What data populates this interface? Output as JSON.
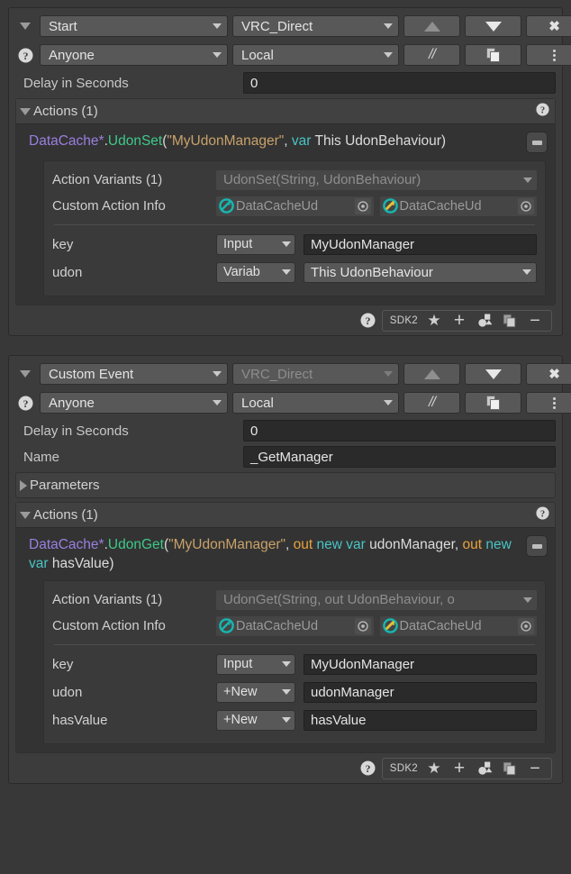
{
  "blocks": [
    {
      "id": "block-start",
      "event": {
        "label": "Start",
        "dimmed": false
      },
      "network": {
        "label": "VRC_Direct",
        "dimmed": false
      },
      "buttons": {
        "move_up": "move-up",
        "move_down": "move-down",
        "remove": "✖"
      },
      "target": {
        "label": "Anyone"
      },
      "scope": {
        "label": "Local"
      },
      "comment_label": "//",
      "delay": {
        "label": "Delay in Seconds",
        "value": "0"
      },
      "name_field": null,
      "parameters_section": null,
      "actions": {
        "title": "Actions (1)",
        "expanded": true,
        "items": [
          {
            "code": {
              "type": "DataCache*",
              "dot": ".",
              "fn": "UdonSet",
              "open": "(",
              "string": "\"MyUdonManager\"",
              "comma": ", ",
              "keyword": "var",
              "tail": " This UdonBehaviour)"
            },
            "variants": {
              "label": "Action Variants (1)",
              "value": "UdonSet(String, UdonBehaviour)"
            },
            "custom_info": {
              "label": "Custom Action Info",
              "slots": [
                {
                  "name": "DataCacheUd",
                  "icon": "udon-script-icon"
                },
                {
                  "name": "DataCacheUd",
                  "icon": "udon-script-arrow-icon"
                }
              ]
            },
            "params": [
              {
                "name": "key",
                "mode": "Input",
                "value": "MyUdonManager",
                "value_is_dropdown": false
              },
              {
                "name": "udon",
                "mode": "Variab",
                "value": "This UdonBehaviour",
                "value_is_dropdown": true
              }
            ]
          }
        ]
      },
      "footer": {
        "sdk": "SDK2"
      }
    },
    {
      "id": "block-custom-event",
      "event": {
        "label": "Custom Event",
        "dimmed": false
      },
      "network": {
        "label": "VRC_Direct",
        "dimmed": true
      },
      "buttons": {
        "move_up": "move-up",
        "move_down": "move-down",
        "remove": "✖"
      },
      "target": {
        "label": "Anyone"
      },
      "scope": {
        "label": "Local"
      },
      "comment_label": "//",
      "delay": {
        "label": "Delay in Seconds",
        "value": "0"
      },
      "name_field": {
        "label": "Name",
        "value": "_GetManager"
      },
      "parameters_section": {
        "title": "Parameters",
        "expanded": false
      },
      "actions": {
        "title": "Actions (1)",
        "expanded": true,
        "items": [
          {
            "code": {
              "type": "DataCache*",
              "dot": ".",
              "fn": "UdonGet",
              "open": "(",
              "string": "\"MyUdonManager\"",
              "comma": ", ",
              "out1": "out",
              "newvar1": "new var",
              "mid": " udonManager, ",
              "out2": "out",
              "newvar2": "new var",
              "tail": " hasValue)"
            },
            "variants": {
              "label": "Action Variants (1)",
              "value": "UdonGet(String, out UdonBehaviour, o"
            },
            "custom_info": {
              "label": "Custom Action Info",
              "slots": [
                {
                  "name": "DataCacheUd",
                  "icon": "udon-script-icon"
                },
                {
                  "name": "DataCacheUd",
                  "icon": "udon-script-arrow-icon"
                }
              ]
            },
            "params": [
              {
                "name": "key",
                "mode": "Input",
                "value": "MyUdonManager",
                "value_is_dropdown": false
              },
              {
                "name": "udon",
                "mode": "+New",
                "value": "udonManager",
                "value_is_dropdown": false
              },
              {
                "name": "hasValue",
                "mode": "+New",
                "value": "hasValue",
                "value_is_dropdown": false
              }
            ]
          }
        ]
      },
      "footer": {
        "sdk": "SDK2"
      }
    }
  ],
  "colors": {
    "type": "#9a7fe0",
    "function": "#3ec98a",
    "string": "#c9a26a",
    "keyword": "#49c4c4",
    "out": "#e8a33d",
    "icon_teal": "#17b6b0",
    "icon_gold": "#e2c13a"
  }
}
